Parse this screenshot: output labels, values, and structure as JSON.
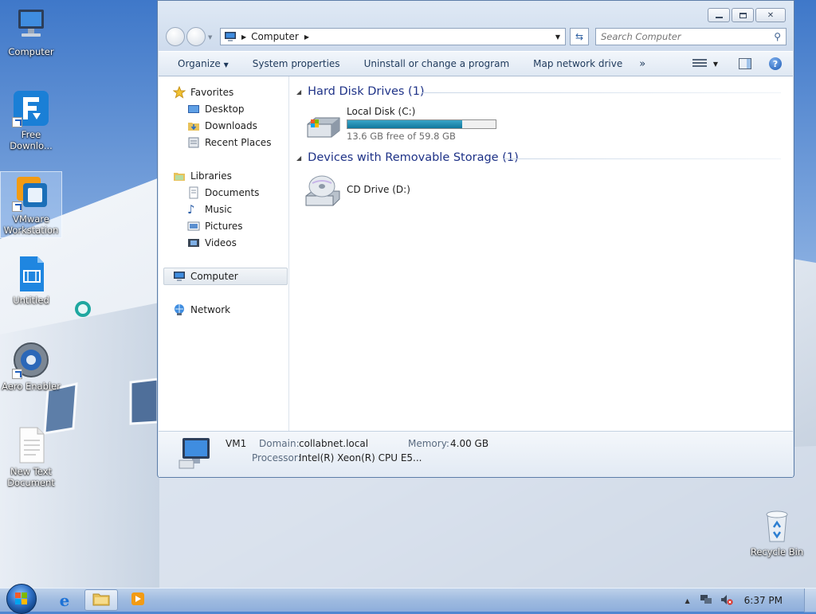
{
  "desktop": {
    "icons": [
      {
        "label": "Computer",
        "icon": "computer-icon"
      },
      {
        "label": "Free Downlo...",
        "icon": "free-download-manager-icon"
      },
      {
        "label": "VMware Workstation",
        "icon": "vmware-workstation-icon"
      },
      {
        "label": "Untitled",
        "icon": "video-file-icon"
      },
      {
        "label": "Aero Enabler",
        "icon": "aero-enabler-icon"
      },
      {
        "label": "New Text Document",
        "icon": "text-document-icon"
      },
      {
        "label": "Recycle Bin",
        "icon": "recycle-bin-icon"
      }
    ]
  },
  "window": {
    "address": {
      "location": "Computer"
    },
    "search": {
      "placeholder": "Search Computer"
    },
    "toolbar": {
      "organize": "Organize",
      "system_properties": "System properties",
      "uninstall": "Uninstall or change a program",
      "map_drive": "Map network drive",
      "more": "»"
    },
    "nav": {
      "favorites": "Favorites",
      "desktop": "Desktop",
      "downloads": "Downloads",
      "recent_places": "Recent Places",
      "libraries": "Libraries",
      "documents": "Documents",
      "music": "Music",
      "pictures": "Pictures",
      "videos": "Videos",
      "computer": "Computer",
      "network": "Network"
    },
    "groups": {
      "hdd_title": "Hard Disk Drives (1)",
      "removable_title": "Devices with Removable Storage (1)"
    },
    "drives": {
      "c_name": "Local Disk (C:)",
      "c_space": "13.6 GB free of 59.8 GB",
      "c_used_fraction": 0.773,
      "d_name": "CD Drive (D:)"
    },
    "details": {
      "name": "VM1",
      "domain_label": "Domain:",
      "domain": "collabnet.local",
      "memory_label": "Memory:",
      "memory": "4.00 GB",
      "processor_label": "Processor:",
      "processor": "Intel(R) Xeon(R) CPU E5..."
    }
  },
  "taskbar": {
    "clock": "6:37 PM"
  }
}
